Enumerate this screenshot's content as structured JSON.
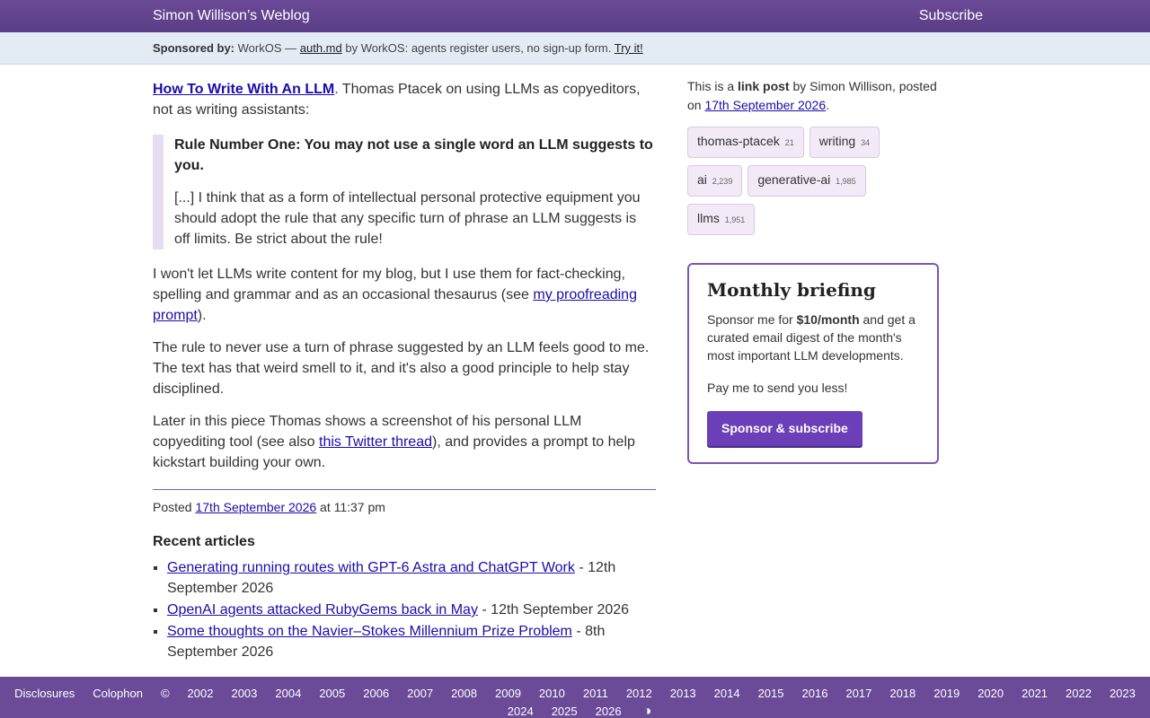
{
  "header": {
    "site_title": "Simon Willison’s Weblog",
    "subscribe": "Subscribe"
  },
  "sponsor": {
    "label": "Sponsored by:",
    "text_before": "WorkOS —",
    "link": "auth.md",
    "text_after": "by WorkOS: agents register users, no sign-up form.",
    "cta": "Try it!"
  },
  "post": {
    "title_link": "How To Write With An LLM",
    "intro_rest": ". Thomas Ptacek on using LLMs as copyeditors, not as writing assistants:",
    "quote_strong": "Rule Number One: You may not use a single word an LLM suggests to you.",
    "quote_rest": "[...] I think that as a form of intellectual personal protective equipment you should adopt the rule that any specific turn of phrase an LLM suggests is off limits. Be strict about the rule!",
    "p2_before": "I won't let LLMs write content for my blog, but I use them for fact-checking, spelling and grammar and as an occasional thesaurus (see ",
    "p2_link": "my proofreading prompt",
    "p2_after": ").",
    "p3": "The rule to never use a turn of phrase suggested by an LLM feels good to me. The text has that weird smell to it, and it's also a good principle to help stay disciplined.",
    "p4_before": "Later in this piece Thomas shows a screenshot of his personal LLM copyediting tool (see also ",
    "p4_link": "this Twitter thread",
    "p4_after": "), and provides a prompt to help kickstart building your own.",
    "posted_label": "Posted",
    "posted_date": "17th September 2026",
    "posted_time": "at 11:37 pm"
  },
  "recent": {
    "heading": "Recent articles",
    "items": [
      {
        "title": "Generating running routes with GPT-6 Astra and ChatGPT Work",
        "date": "- 12th September 2026"
      },
      {
        "title": "OpenAI agents attacked RubyGems back in May",
        "date": "- 12th September 2026"
      },
      {
        "title": "Some thoughts on the Navier–Stokes Millennium Prize Problem",
        "date": "- 8th September 2026"
      }
    ]
  },
  "sidebar": {
    "meta_prefix": "This is a",
    "meta_type": "link post",
    "meta_by": "by Simon Willison, posted on",
    "meta_date": "17th September 2026",
    "meta_end": ".",
    "tags": [
      {
        "name": "thomas-ptacek",
        "count": "21"
      },
      {
        "name": "writing",
        "count": "34"
      },
      {
        "name": "ai",
        "count": "2,239"
      },
      {
        "name": "generative-ai",
        "count": "1,985"
      },
      {
        "name": "llms",
        "count": "1,951"
      }
    ],
    "briefing": {
      "title": "Monthly briefing",
      "text_before": "Sponsor me for",
      "price": "$10/month",
      "text_after": "and get a curated email digest of the month's most important LLM developments.",
      "text2": "Pay me to send you less!",
      "button": "Sponsor & subscribe"
    }
  },
  "footer": {
    "disclosures": "Disclosures",
    "colophon": "Colophon",
    "copyright": "©",
    "years": [
      "2002",
      "2003",
      "2004",
      "2005",
      "2006",
      "2007",
      "2008",
      "2009",
      "2010",
      "2011",
      "2012",
      "2013",
      "2014",
      "2015",
      "2016",
      "2017",
      "2018",
      "2019",
      "2020",
      "2021",
      "2022",
      "2023",
      "2024",
      "2025",
      "2026"
    ],
    "contrast_icon": "◑"
  },
  "colors": {
    "header_bg": "#5b3d87",
    "sponsor_bg": "#e3ecf5",
    "accent": "#6b3fb8",
    "link": "#1a0dab"
  }
}
